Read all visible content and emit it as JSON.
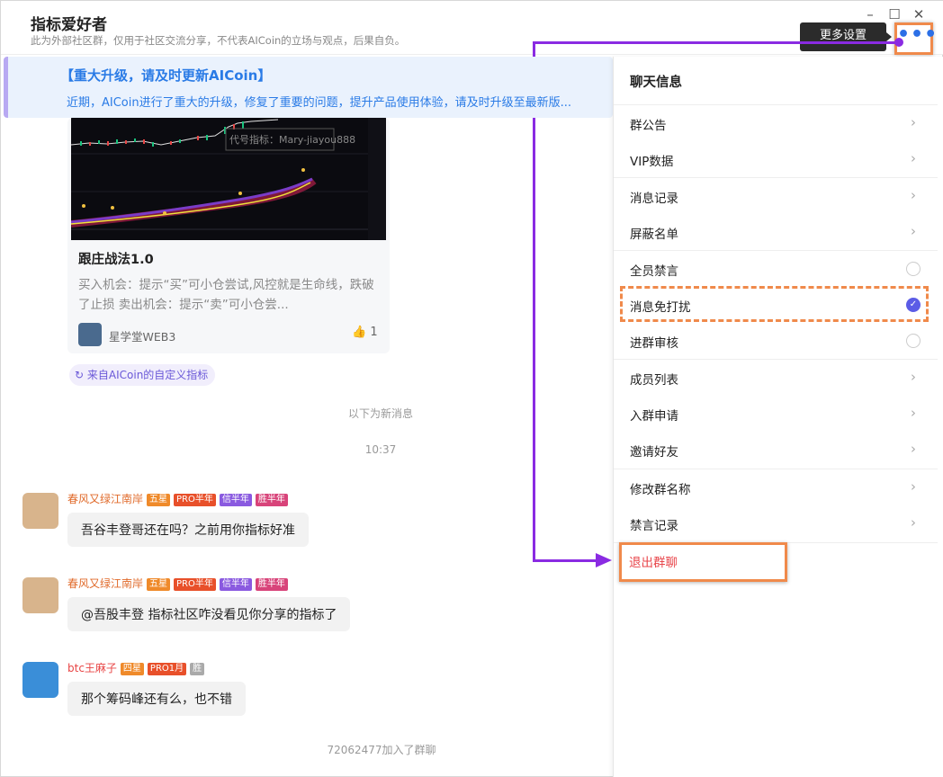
{
  "header": {
    "title": "指标爱好者",
    "subtitle": "此为外部社区群，仅用于社区交流分享，不代表AICoin的立场与观点，后果自负。",
    "minimize": "–",
    "maximize": "☐",
    "close": "✕",
    "more_label": "•••",
    "tooltip": "更多设置"
  },
  "banner": {
    "title": "【重大升级，请及时更新AICoin】",
    "body": "近期，AICoin进行了重大的升级，修复了重要的问题，提升产品使用体验，请及时升级至最新版..."
  },
  "card": {
    "chart_watermark": "代号指标：Mary-jiayou888",
    "title": "跟庄战法1.0",
    "desc": "买入机会：提示“买”可小仓尝试,风控就是生命线，跌破了止损 卖出机会：提示“卖”可小仓尝...",
    "author": "星学堂WEB3",
    "likes": "1",
    "like_icon": "👍",
    "source": "来自AICoin的自定义指标"
  },
  "separators": {
    "new_messages": "以下为新消息",
    "time": "10:37",
    "joined": "72062477加入了群聊"
  },
  "messages": [
    {
      "name": "春风又绿江南岸",
      "level": "五星",
      "badges": [
        "PRO半年",
        "信半年",
        "胜半年"
      ],
      "text": "吾谷丰登哥还在吗？之前用你指标好准"
    },
    {
      "name": "春风又绿江南岸",
      "level": "五星",
      "badges": [
        "PRO半年",
        "信半年",
        "胜半年"
      ],
      "text": "@吾股丰登  指标社区咋没看见你分享的指标了"
    },
    {
      "name": "btc王麻子",
      "level": "四星",
      "badges": [
        "PRO1月",
        "胜"
      ],
      "text": "那个筹码峰还有么，也不错"
    }
  ],
  "side": {
    "title": "聊天信息",
    "items": [
      {
        "label": "群公告",
        "type": "chevron"
      },
      {
        "label": "VIP数据",
        "type": "chevron"
      },
      {
        "label": "消息记录",
        "type": "chevron"
      },
      {
        "label": "屏蔽名单",
        "type": "chevron"
      },
      {
        "label": "全员禁言",
        "type": "radio"
      },
      {
        "label": "消息免打扰",
        "type": "checked"
      },
      {
        "label": "进群审核",
        "type": "radio"
      },
      {
        "label": "成员列表",
        "type": "chevron"
      },
      {
        "label": "入群申请",
        "type": "chevron"
      },
      {
        "label": "邀请好友",
        "type": "chevron"
      },
      {
        "label": "修改群名称",
        "type": "chevron"
      },
      {
        "label": "禁言记录",
        "type": "chevron"
      }
    ],
    "exit": "退出群聊",
    "chevron": "›",
    "check": "✓"
  },
  "colors": {
    "accent": "#2a7be6",
    "highlight": "#f08a4b",
    "arrow": "#8a2be2",
    "danger": "#e8454a"
  }
}
